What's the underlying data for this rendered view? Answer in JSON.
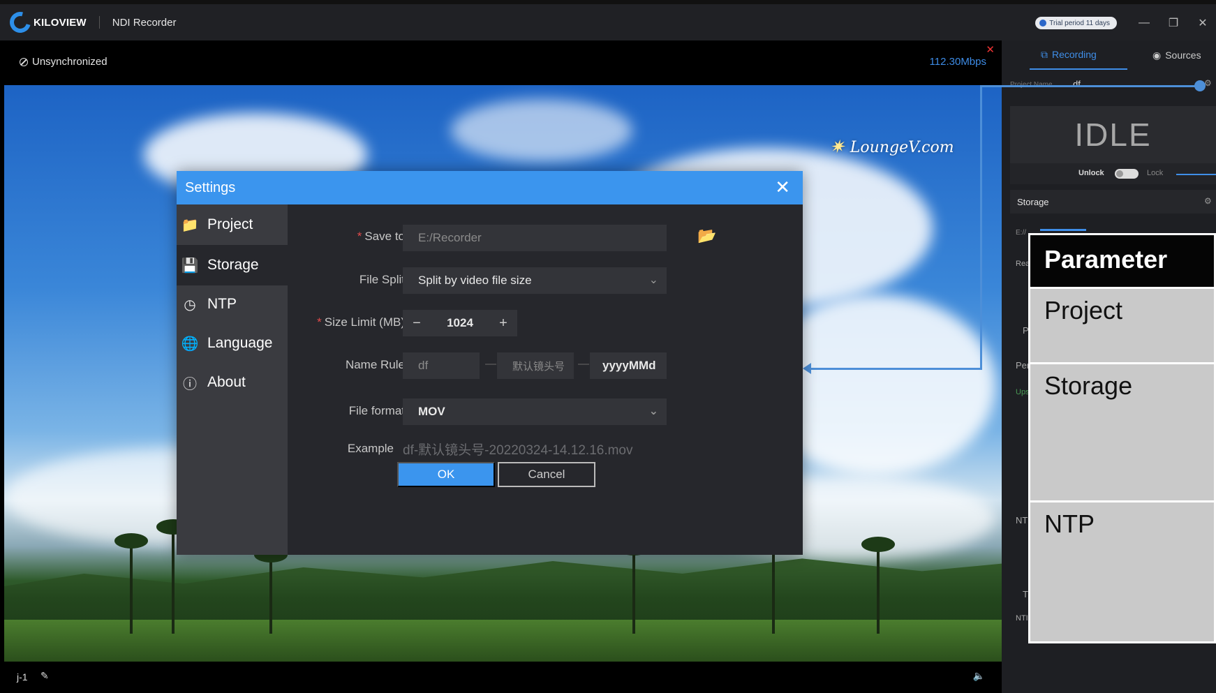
{
  "titlebar": {
    "brand": "KILOVIEW",
    "app_name": "NDI Recorder",
    "trial_badge": "Trial period 11 days",
    "minimize": "—",
    "restore": "❐",
    "close": "✕"
  },
  "stream": {
    "sync_status": "Unsynchronized",
    "bitrate": "112.30Mbps",
    "close": "✕",
    "frame_counter": "j-1",
    "watermark": "LoungeV.com"
  },
  "right_panel": {
    "tabs": [
      {
        "label": "Recording",
        "icon": "record-icon"
      },
      {
        "label": "Sources",
        "icon": "broadcast-icon"
      }
    ],
    "project_name_label": "Project Name",
    "project_name_value": "df",
    "state": "IDLE",
    "unlock_label": "Unlock",
    "lock_label": "Lock",
    "storage_title": "Storage",
    "storage_path": "E://",
    "stubs": [
      "Rea",
      "P",
      "Per",
      "Ups",
      "NT",
      "TI",
      "NTI"
    ]
  },
  "param_table": {
    "header": "Parameter",
    "rows": [
      "Project",
      "Storage",
      "NTP"
    ]
  },
  "dialog": {
    "title": "Settings",
    "close": "✕",
    "nav": [
      {
        "label": "Project",
        "icon": "folder-icon",
        "active": false
      },
      {
        "label": "Storage",
        "icon": "floppy-icon",
        "active": true
      },
      {
        "label": "NTP",
        "icon": "clock-icon",
        "active": false
      },
      {
        "label": "Language",
        "icon": "globe-icon",
        "active": false
      },
      {
        "label": "About",
        "icon": "info-icon",
        "active": false
      }
    ],
    "form": {
      "save_to_label": "Save to",
      "save_to_value": "E:/Recorder",
      "file_split_label": "File Split",
      "file_split_value": "Split by video file size",
      "size_limit_label": "Size Limit (MB)",
      "size_limit_value": "1024",
      "stepper_minus": "−",
      "stepper_plus": "+",
      "name_rule_label": "Name Rule",
      "name_rule_parts": [
        "df",
        "默认镜头号",
        "yyyyMMd"
      ],
      "file_format_label": "File format",
      "file_format_value": "MOV",
      "example_label": "Example",
      "example_value": "df-默认镜头号-20220324-14.12.16.mov",
      "required_mark": "*"
    },
    "ok_label": "OK",
    "cancel_label": "Cancel"
  },
  "colors": {
    "accent": "#3b95ee",
    "panel_bg": "#26272c",
    "nav_bg": "#3a3b40",
    "required": "#e24a4a"
  }
}
